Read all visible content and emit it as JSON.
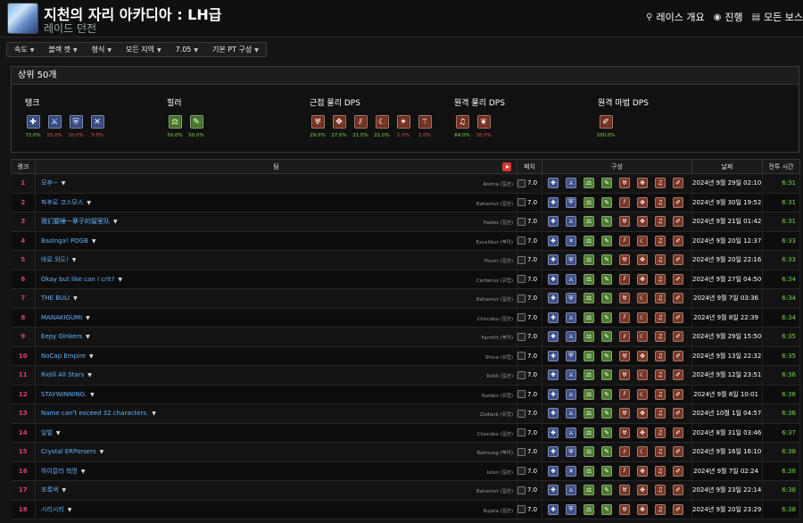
{
  "header": {
    "title": "지천의 자리 아카디아 : LH급",
    "subtitle": "레이드 던전",
    "nav": [
      {
        "icon": "runner-icon",
        "glyph": "⚲",
        "label": "레이스 개요"
      },
      {
        "icon": "globe-icon",
        "glyph": "◉",
        "label": "진행"
      },
      {
        "icon": "list-icon",
        "glyph": "▤",
        "label": "모든 보스"
      }
    ]
  },
  "filters": [
    "속도",
    "블랙 캣",
    "형식",
    "모든 지역",
    "7.05",
    "기본 PT 구성"
  ],
  "summary": {
    "title": "상위 50개",
    "groups": [
      {
        "label": "탱크",
        "role": "tank",
        "jobs": [
          {
            "glyph": "✚",
            "pct": "72.0%",
            "color": "#7ddc3a"
          },
          {
            "glyph": "⚔",
            "pct": "15.0%",
            "color": "#e05a4a"
          },
          {
            "glyph": "⛨",
            "pct": "10.0%",
            "color": "#e05a4a"
          },
          {
            "glyph": "✕",
            "pct": "3.0%",
            "color": "#e05a4a"
          }
        ]
      },
      {
        "label": "힐러",
        "role": "heal",
        "jobs": [
          {
            "glyph": "⚖",
            "pct": "50.0%",
            "color": "#7ddc3a"
          },
          {
            "glyph": "✎",
            "pct": "50.0%",
            "color": "#7ddc3a"
          }
        ]
      },
      {
        "label": "근접 물리 DPS",
        "role": "dps",
        "jobs": [
          {
            "glyph": "♅",
            "pct": "29.0%",
            "color": "#7ddc3a"
          },
          {
            "glyph": "✥",
            "pct": "27.0%",
            "color": "#7ddc3a"
          },
          {
            "glyph": "⫽",
            "pct": "21.0%",
            "color": "#7ddc3a"
          },
          {
            "glyph": "☾",
            "pct": "21.0%",
            "color": "#7ddc3a"
          },
          {
            "glyph": "✦",
            "pct": "1.0%",
            "color": "#e05a4a"
          },
          {
            "glyph": "⚚",
            "pct": "1.0%",
            "color": "#e05a4a"
          }
        ]
      },
      {
        "label": "원격 물리 DPS",
        "role": "dps",
        "jobs": [
          {
            "glyph": "♫",
            "pct": "84.0%",
            "color": "#7ddc3a"
          },
          {
            "glyph": "❦",
            "pct": "16.0%",
            "color": "#e05a4a"
          }
        ]
      },
      {
        "label": "원격 마법 DPS",
        "role": "dps",
        "jobs": [
          {
            "glyph": "✐",
            "pct": "100.0%",
            "color": "#7ddc3a"
          }
        ]
      }
    ]
  },
  "table": {
    "headers": {
      "rank": "랭크",
      "team": "팀",
      "patch": "패치",
      "comp": "구성",
      "date": "날짜",
      "time": "전투 시간"
    },
    "rows": [
      {
        "rank": "1",
        "team": "모후~",
        "server": "Anima (일본)",
        "patch": "7.0",
        "comp": [
          "t0",
          "t1",
          "h0",
          "h1",
          "d0",
          "d1",
          "d6",
          "d8"
        ],
        "date": "2024년 9월 29일 02:10",
        "time": "6:31"
      },
      {
        "rank": "2",
        "team": "파후로 코스모스",
        "server": "Bahamut (일본)",
        "patch": "7.0",
        "comp": [
          "t0",
          "t2",
          "h0",
          "h1",
          "d2",
          "d1",
          "d6",
          "d8"
        ],
        "date": "2024년 9월 30일 19:52",
        "time": "6:31"
      },
      {
        "rank": "3",
        "team": "我们要睡一辈子的留室队",
        "server": "Hades (일본)",
        "patch": "7.0",
        "comp": [
          "t0",
          "t1",
          "h0",
          "h1",
          "d0",
          "d1",
          "d6",
          "d8"
        ],
        "date": "2024년 9월 21일 01:42",
        "time": "6:31"
      },
      {
        "rank": "4",
        "team": "Bazinga! POGB",
        "server": "Excalibur (북미)",
        "patch": "7.0",
        "comp": [
          "t0",
          "t3",
          "h0",
          "h1",
          "d2",
          "d3",
          "d6",
          "d8"
        ],
        "date": "2024년 9월 20일 12:37",
        "time": "6:33"
      },
      {
        "rank": "5",
        "team": "바로 외도!",
        "server": "Fenrir (일본)",
        "patch": "7.0",
        "comp": [
          "t0",
          "t2",
          "h0",
          "h1",
          "d0",
          "d1",
          "d6",
          "d8"
        ],
        "date": "2024년 9월 20일 22:16",
        "time": "6:33"
      },
      {
        "rank": "6",
        "team": "Okay but like can I crit?",
        "server": "Cerberus (유럽)",
        "patch": "7.0",
        "comp": [
          "t0",
          "t1",
          "h0",
          "h1",
          "d2",
          "d1",
          "d6",
          "d8"
        ],
        "date": "2024년 9월 27일 04:50",
        "time": "6:34"
      },
      {
        "rank": "7",
        "team": "THE BULI",
        "server": "Bahamut (일본)",
        "patch": "7.0",
        "comp": [
          "t0",
          "t2",
          "h0",
          "h1",
          "d0",
          "d3",
          "d6",
          "d8"
        ],
        "date": "2024년 9월 7일 03:36",
        "time": "6:34"
      },
      {
        "rank": "8",
        "team": "MANAKIGUMI",
        "server": "Chocobo (일본)",
        "patch": "7.0",
        "comp": [
          "t0",
          "t1",
          "h0",
          "h1",
          "d2",
          "d3",
          "d6",
          "d8"
        ],
        "date": "2024년 9월 8일 22:39",
        "time": "6:34"
      },
      {
        "rank": "9",
        "team": "Eepy Oinkers",
        "server": "Famfrit (북미)",
        "patch": "7.0",
        "comp": [
          "t0",
          "t1",
          "h0",
          "h1",
          "d2",
          "d3",
          "d6",
          "d8"
        ],
        "date": "2024년 9월 29일 15:50",
        "time": "6:35"
      },
      {
        "rank": "10",
        "team": "NoCap Empire",
        "server": "Shiva (유럽)",
        "patch": "7.0",
        "comp": [
          "t0",
          "t2",
          "h0",
          "h1",
          "d0",
          "d1",
          "d6",
          "d8"
        ],
        "date": "2024년 9월 13일 22:32",
        "time": "6:35"
      },
      {
        "rank": "11",
        "team": "Ridill All Stars",
        "server": "Ridill (일본)",
        "patch": "7.0",
        "comp": [
          "t0",
          "t1",
          "h0",
          "h1",
          "d0",
          "d3",
          "d6",
          "d8"
        ],
        "date": "2024년 9월 12일 23:51",
        "time": "6:36"
      },
      {
        "rank": "12",
        "team": "STAYWINNING.",
        "server": "Raiden (유럽)",
        "patch": "7.0",
        "comp": [
          "t0",
          "t1",
          "h0",
          "h1",
          "d2",
          "d3",
          "d6",
          "d8"
        ],
        "date": "2024년 9월 8일 10:01",
        "time": "6:36"
      },
      {
        "rank": "13",
        "team": "Name can't exceed 32 characters.",
        "server": "Zodiark (유럽)",
        "patch": "7.0",
        "comp": [
          "t0",
          "t1",
          "h0",
          "h1",
          "d0",
          "d1",
          "d6",
          "d8"
        ],
        "date": "2024년 10월 1일 04:57",
        "time": "6:36"
      },
      {
        "rank": "14",
        "team": "일벌",
        "server": "Chocobo (일본)",
        "patch": "7.0",
        "comp": [
          "t0",
          "t1",
          "h0",
          "h1",
          "d0",
          "d1",
          "d6",
          "d8"
        ],
        "date": "2024년 8월 31일 03:46",
        "time": "6:37"
      },
      {
        "rank": "15",
        "team": "Crystal ERParsers",
        "server": "Balmung (북미)",
        "patch": "7.0",
        "comp": [
          "t0",
          "t2",
          "h0",
          "h1",
          "d2",
          "d3",
          "d6",
          "d8"
        ],
        "date": "2024년 9월 16일 16:10",
        "time": "6:38"
      },
      {
        "rank": "16",
        "team": "하이칼라 혁명",
        "server": "Ixion (일본)",
        "patch": "7.0",
        "comp": [
          "t0",
          "t3",
          "h0",
          "h1",
          "d2",
          "d1",
          "d6",
          "d8"
        ],
        "date": "2024년 9월 7일 02:24",
        "time": "6:38"
      },
      {
        "rank": "17",
        "team": "초록색",
        "server": "Bahamut (일본)",
        "patch": "7.0",
        "comp": [
          "t0",
          "t1",
          "h0",
          "h1",
          "d0",
          "d1",
          "d6",
          "d8"
        ],
        "date": "2024년 9월 23일 22:14",
        "time": "6:38"
      },
      {
        "rank": "18",
        "team": "시리시리",
        "server": "Kujata (일본)",
        "patch": "7.0",
        "comp": [
          "t0",
          "t2",
          "h0",
          "h1",
          "d0",
          "d1",
          "d6",
          "d8"
        ],
        "date": "2024년 9월 20일 23:29",
        "time": "6:38"
      }
    ]
  },
  "colors": {
    "rank": "#e0407a",
    "team": "#5eb3ff",
    "time": "#6fdc3c",
    "tank": "#3b4f8a",
    "heal": "#4b7a2c",
    "dps": "#7a3524"
  }
}
